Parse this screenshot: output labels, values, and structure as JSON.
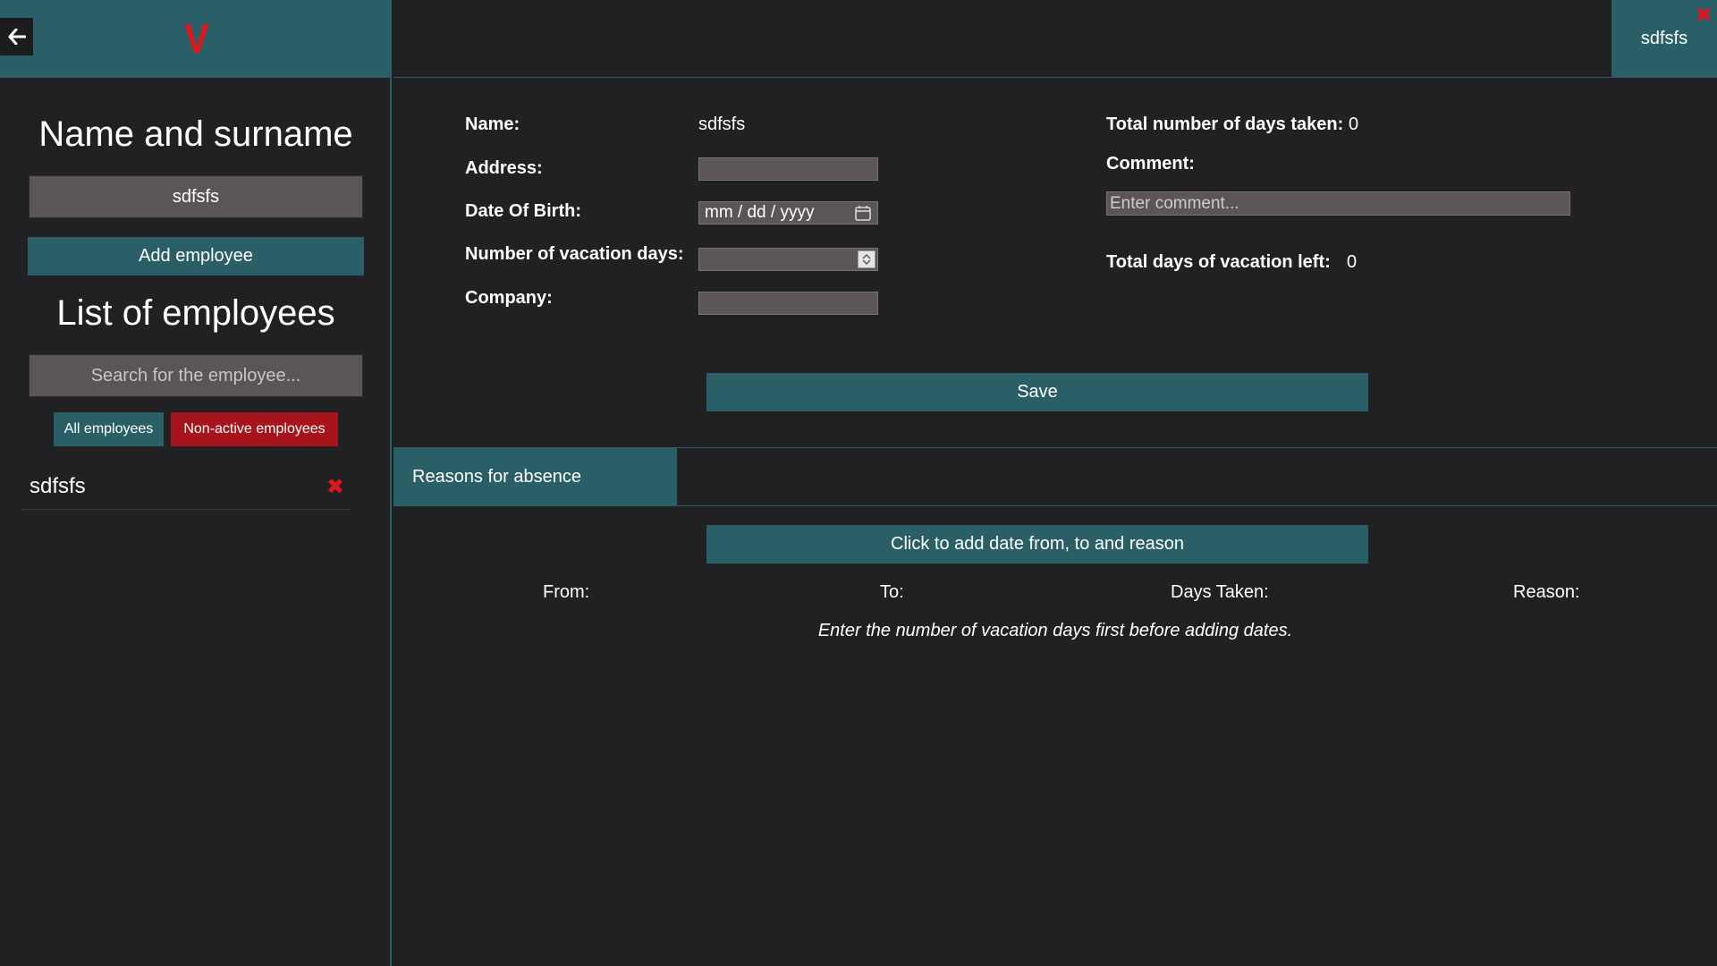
{
  "sidebar": {
    "logo_letter": "V",
    "name_section_title": "Name and surname",
    "name_input_value": "sdfsfs",
    "add_employee_label": "Add employee",
    "list_title": "List of employees",
    "search_placeholder": "Search for the employee...",
    "filters": {
      "all_label": "All employees",
      "non_active_label": "Non-active employees"
    },
    "employees": [
      {
        "name": "sdfsfs"
      }
    ]
  },
  "header": {
    "employee_tab_label": "sdfsfs"
  },
  "form": {
    "name_label": "Name:",
    "name_value": "sdfsfs",
    "address_label": "Address:",
    "address_value": "",
    "dob_label": "Date Of Birth:",
    "dob_placeholder": "mm / dd / yyyy",
    "vacation_days_label": "Number of vacation days:",
    "vacation_days_value": "",
    "company_label": "Company:",
    "company_value": "",
    "total_taken_label": "Total number of days taken:",
    "total_taken_value": "0",
    "comment_label": "Comment:",
    "comment_placeholder": "Enter comment...",
    "total_left_label": "Total days of vacation left:",
    "total_left_value": "0",
    "save_label": "Save"
  },
  "absence": {
    "tab_label": "Reasons for absence",
    "add_button_label": "Click to add date from, to and reason",
    "columns": {
      "from": "From:",
      "to": "To:",
      "days_taken": "Days Taken:",
      "reason": "Reason:"
    },
    "hint": "Enter the number of vacation days first before adding dates."
  },
  "colors": {
    "accent": "#2a5f68",
    "danger": "#a8141b",
    "background": "#212023",
    "input_bg": "#5b5558"
  }
}
